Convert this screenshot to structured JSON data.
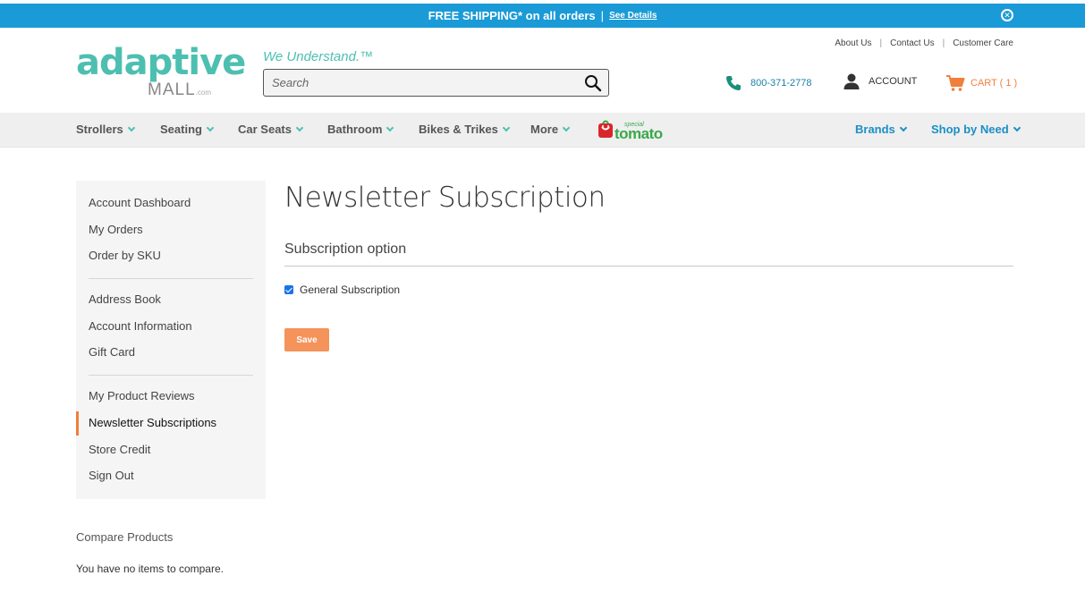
{
  "promo": {
    "text": "FREE SHIPPING* on all orders",
    "separator": "|",
    "link": "See Details"
  },
  "header": {
    "logo_word": "adaptive",
    "logo_mall": "MALL",
    "logo_com": ".com",
    "tagline": "We Understand.™",
    "search_placeholder": "Search",
    "phone": "800-371-2778",
    "account": "ACCOUNT",
    "cart": "CART ( 1 )",
    "top_links": [
      "About Us",
      "Contact Us",
      "Customer Care"
    ]
  },
  "nav": {
    "items": [
      "Strollers",
      "Seating",
      "Car Seats",
      "Bathroom",
      "Bikes & Trikes",
      "More"
    ],
    "right_items": [
      "Brands",
      "Shop by Need"
    ],
    "partner_small": "special",
    "partner_big": "tomato"
  },
  "sidebar": {
    "group1": [
      "Account Dashboard",
      "My Orders",
      "Order by SKU"
    ],
    "group2": [
      "Address Book",
      "Account Information",
      "Gift Card"
    ],
    "group3": [
      "My Product Reviews",
      "Newsletter Subscriptions",
      "Store Credit",
      "Sign Out"
    ],
    "active": "Newsletter Subscriptions"
  },
  "compare": {
    "title": "Compare Products",
    "empty": "You have no items to compare."
  },
  "main": {
    "title": "Newsletter Subscription",
    "section": "Subscription option",
    "checkbox_label": "General Subscription",
    "save": "Save"
  },
  "colors": {
    "promo_bg": "#1a9ad6",
    "brand_teal": "#4dbfb1",
    "accent_orange": "#f07f3c",
    "link_blue": "#1a8fc6"
  }
}
